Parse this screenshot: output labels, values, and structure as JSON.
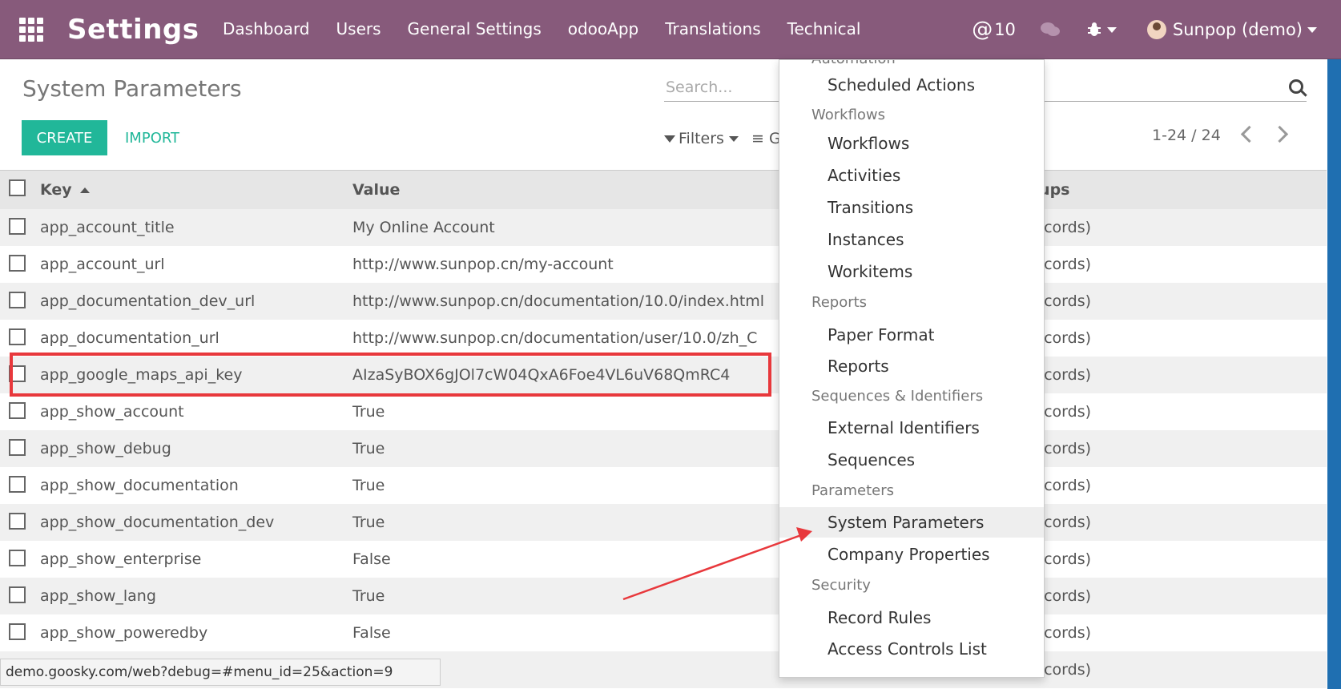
{
  "navbar": {
    "brand": "Settings",
    "menu": [
      "Dashboard",
      "Users",
      "General Settings",
      "odooApp",
      "Translations",
      "Technical"
    ],
    "mention_count": "10",
    "user": "Sunpop (demo)",
    "color": "#875a7b"
  },
  "control_panel": {
    "title": "System Parameters",
    "search_placeholder": "Search...",
    "create_label": "CREATE",
    "import_label": "IMPORT",
    "filters_label": "Filters",
    "groupby_label": "G",
    "pager": "1-24 / 24"
  },
  "table": {
    "headers": {
      "key": "Key",
      "value": "Value",
      "groups": "oups"
    },
    "rows": [
      {
        "key": "app_account_title",
        "value": "My Online Account",
        "groups": "records)"
      },
      {
        "key": "app_account_url",
        "value": "http://www.sunpop.cn/my-account",
        "groups": "records)"
      },
      {
        "key": "app_documentation_dev_url",
        "value": "http://www.sunpop.cn/documentation/10.0/index.html",
        "groups": "records)"
      },
      {
        "key": "app_documentation_url",
        "value": "http://www.sunpop.cn/documentation/user/10.0/zh_C",
        "groups": "records)"
      },
      {
        "key": "app_google_maps_api_key",
        "value": "AIzaSyBOX6gJOl7cW04QxA6Foe4VL6uV68QmRC4",
        "groups": "records)"
      },
      {
        "key": "app_show_account",
        "value": "True",
        "groups": "records)"
      },
      {
        "key": "app_show_debug",
        "value": "True",
        "groups": "records)"
      },
      {
        "key": "app_show_documentation",
        "value": "True",
        "groups": "records)"
      },
      {
        "key": "app_show_documentation_dev",
        "value": "True",
        "groups": "records)"
      },
      {
        "key": "app_show_enterprise",
        "value": "False",
        "groups": "records)"
      },
      {
        "key": "app_show_lang",
        "value": "True",
        "groups": "records)"
      },
      {
        "key": "app_show_poweredby",
        "value": "False",
        "groups": "records)"
      },
      {
        "key": "",
        "value": "",
        "groups": "records)"
      }
    ]
  },
  "dropdown": {
    "top_header": "Automation",
    "entries": [
      {
        "type": "item",
        "label": "Scheduled Actions"
      },
      {
        "type": "header",
        "label": "Workflows"
      },
      {
        "type": "item",
        "label": "Workflows"
      },
      {
        "type": "item",
        "label": "Activities"
      },
      {
        "type": "item",
        "label": "Transitions"
      },
      {
        "type": "item",
        "label": "Instances"
      },
      {
        "type": "item",
        "label": "Workitems"
      },
      {
        "type": "header",
        "label": "Reports"
      },
      {
        "type": "item",
        "label": "Paper Format"
      },
      {
        "type": "item",
        "label": "Reports"
      },
      {
        "type": "header",
        "label": "Sequences & Identifiers"
      },
      {
        "type": "item",
        "label": "External Identifiers"
      },
      {
        "type": "item",
        "label": "Sequences"
      },
      {
        "type": "header",
        "label": "Parameters"
      },
      {
        "type": "item",
        "label": "System Parameters",
        "active": true
      },
      {
        "type": "item",
        "label": "Company Properties"
      },
      {
        "type": "header",
        "label": "Security"
      },
      {
        "type": "item",
        "label": "Record Rules"
      },
      {
        "type": "item",
        "label": "Access Controls List"
      }
    ]
  },
  "statusbar": {
    "url": "demo.goosky.com/web?debug=#menu_id=25&action=9"
  },
  "colors": {
    "accent": "#21b799",
    "highlight": "#e8383c"
  }
}
